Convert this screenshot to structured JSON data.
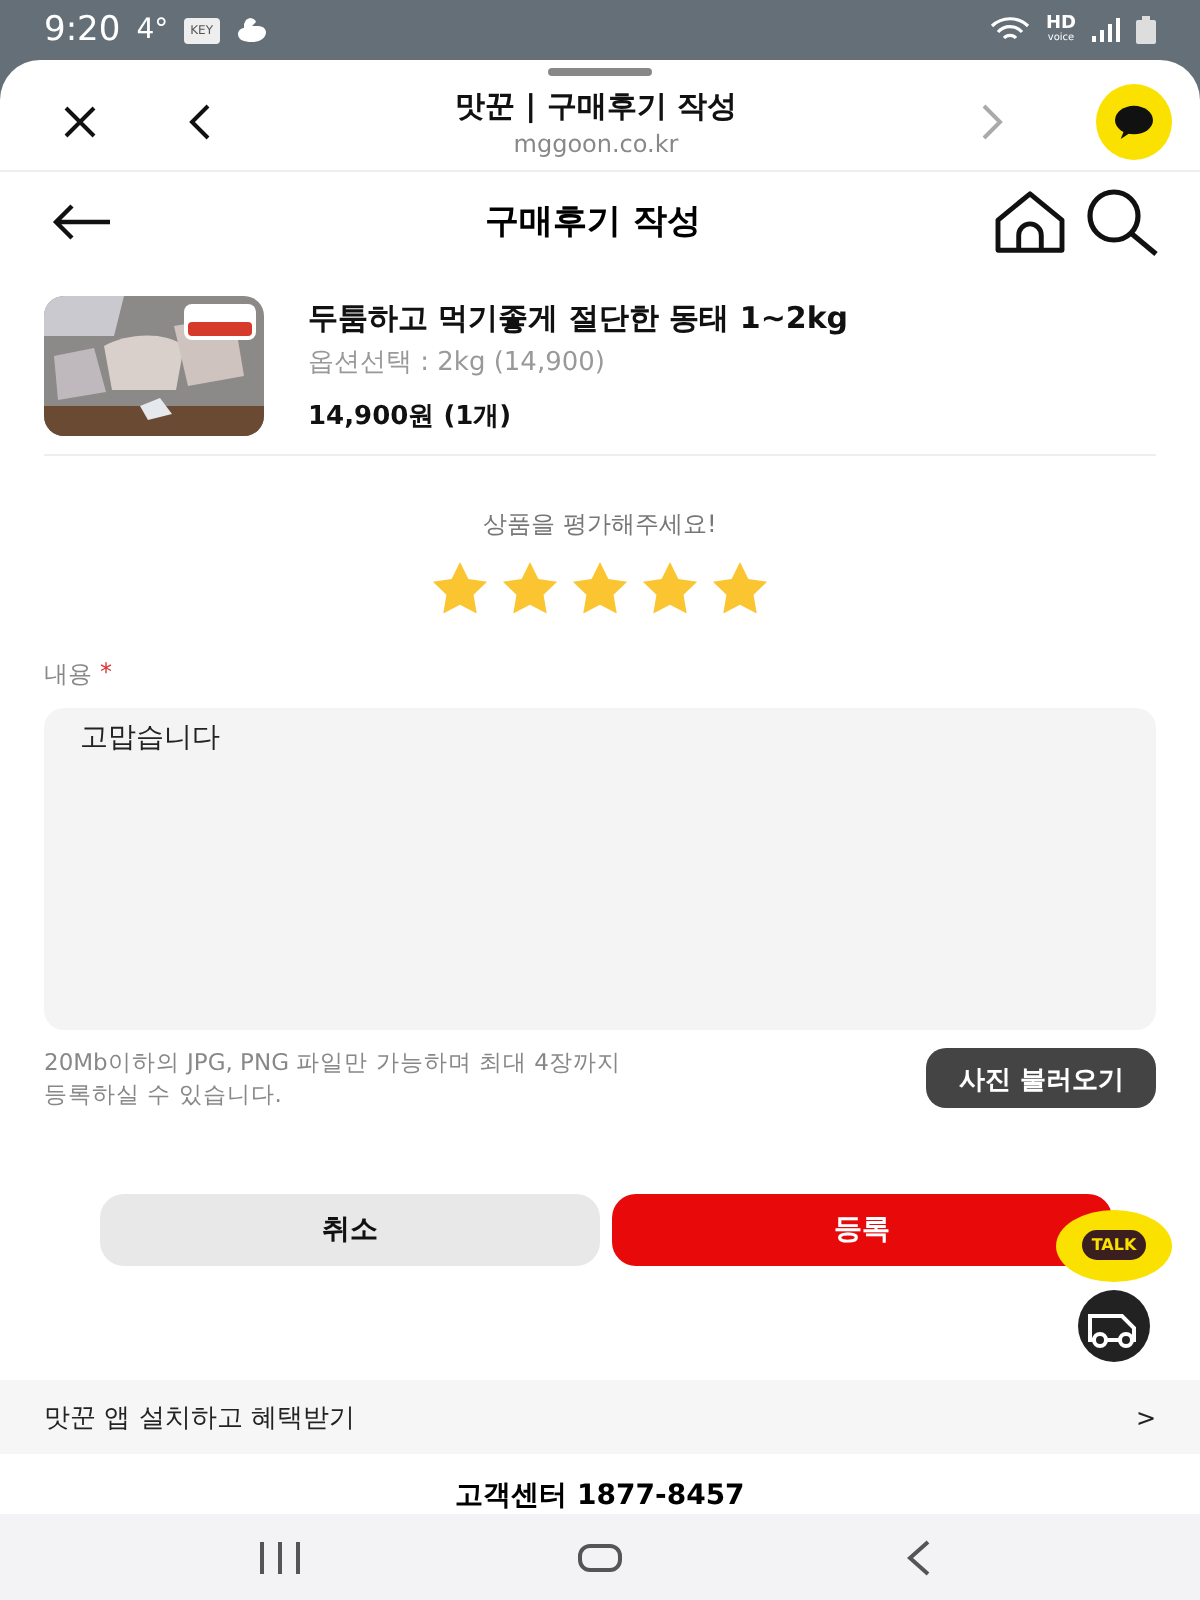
{
  "status_bar": {
    "time": "9:20",
    "temp": "4°",
    "key_badge": "KEY",
    "network": "HD",
    "network_sub": "voice"
  },
  "browser_bar": {
    "title": "맛꾼 | 구매후기 작성",
    "url": "mggoon.co.kr",
    "forward_disabled": true
  },
  "page_header": {
    "title": "구매후기 작성"
  },
  "product": {
    "name": "두툼하고 먹기좋게 절단한 동태 1~2kg",
    "option": "옵션선택 : 2kg (14,900)",
    "price": "14,900원 (1개)"
  },
  "rating": {
    "prompt": "상품을 평가해주세요!",
    "stars": 5
  },
  "content": {
    "label": "내용",
    "required_mark": "*",
    "value": "고맙습니다"
  },
  "upload": {
    "hint": "20Mb이하의 JPG, PNG 파일만 가능하며 최대 4장까지\n등록하실 수 있습니다.",
    "button": "사진 불러오기"
  },
  "actions": {
    "cancel": "취소",
    "submit": "등록"
  },
  "floating": {
    "talk": "TALK"
  },
  "banner": {
    "text": "맛꾼 앱 설치하고 혜택받기",
    "arrow": ">"
  },
  "footer": {
    "text": "고객센터 1877-8457"
  }
}
